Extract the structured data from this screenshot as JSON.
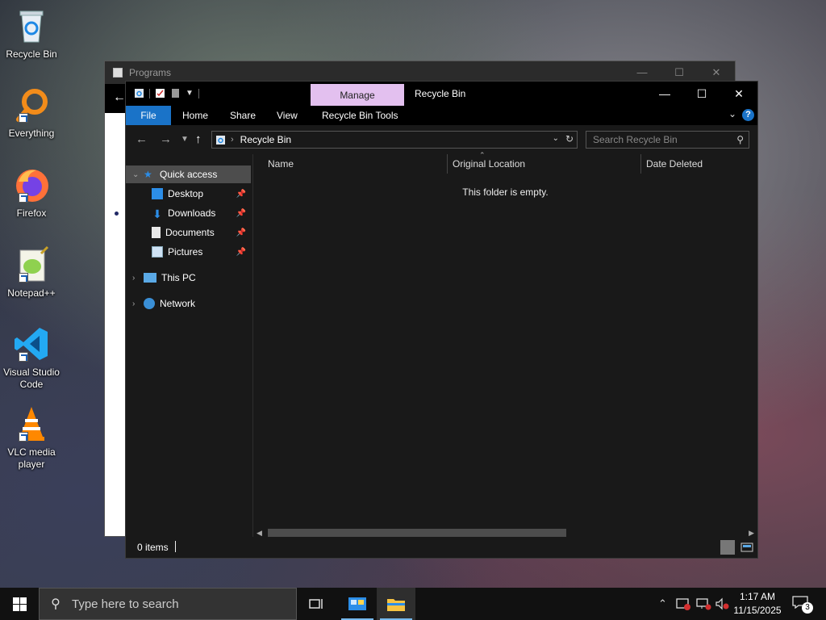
{
  "desktop": {
    "icons": [
      {
        "label": "Recycle Bin"
      },
      {
        "label": "Everything"
      },
      {
        "label": "Firefox"
      },
      {
        "label": "Notepad++"
      },
      {
        "label": "Visual Studio Code"
      },
      {
        "label": "VLC media player"
      }
    ]
  },
  "bg_window": {
    "title": "Programs"
  },
  "window": {
    "title": "Recycle Bin",
    "manage_tab": "Manage",
    "ribbon": {
      "file": "File",
      "home": "Home",
      "share": "Share",
      "view": "View",
      "tools": "Recycle Bin Tools"
    },
    "address": {
      "path": "Recycle Bin",
      "search_placeholder": "Search Recycle Bin"
    },
    "nav": {
      "quick_access": "Quick access",
      "items": [
        "Desktop",
        "Downloads",
        "Documents",
        "Pictures"
      ],
      "this_pc": "This PC",
      "network": "Network"
    },
    "columns": [
      "Name",
      "Original Location",
      "Date Deleted"
    ],
    "empty_message": "This folder is empty.",
    "status": "0 items"
  },
  "taskbar": {
    "search_placeholder": "Type here to search",
    "time": "1:17 AM",
    "date": "11/15/2025",
    "notification_count": "3"
  },
  "colors": {
    "accent": "#1a73c8",
    "manage_tab": "#e3c0ef",
    "selection": "#4d4d4d"
  }
}
